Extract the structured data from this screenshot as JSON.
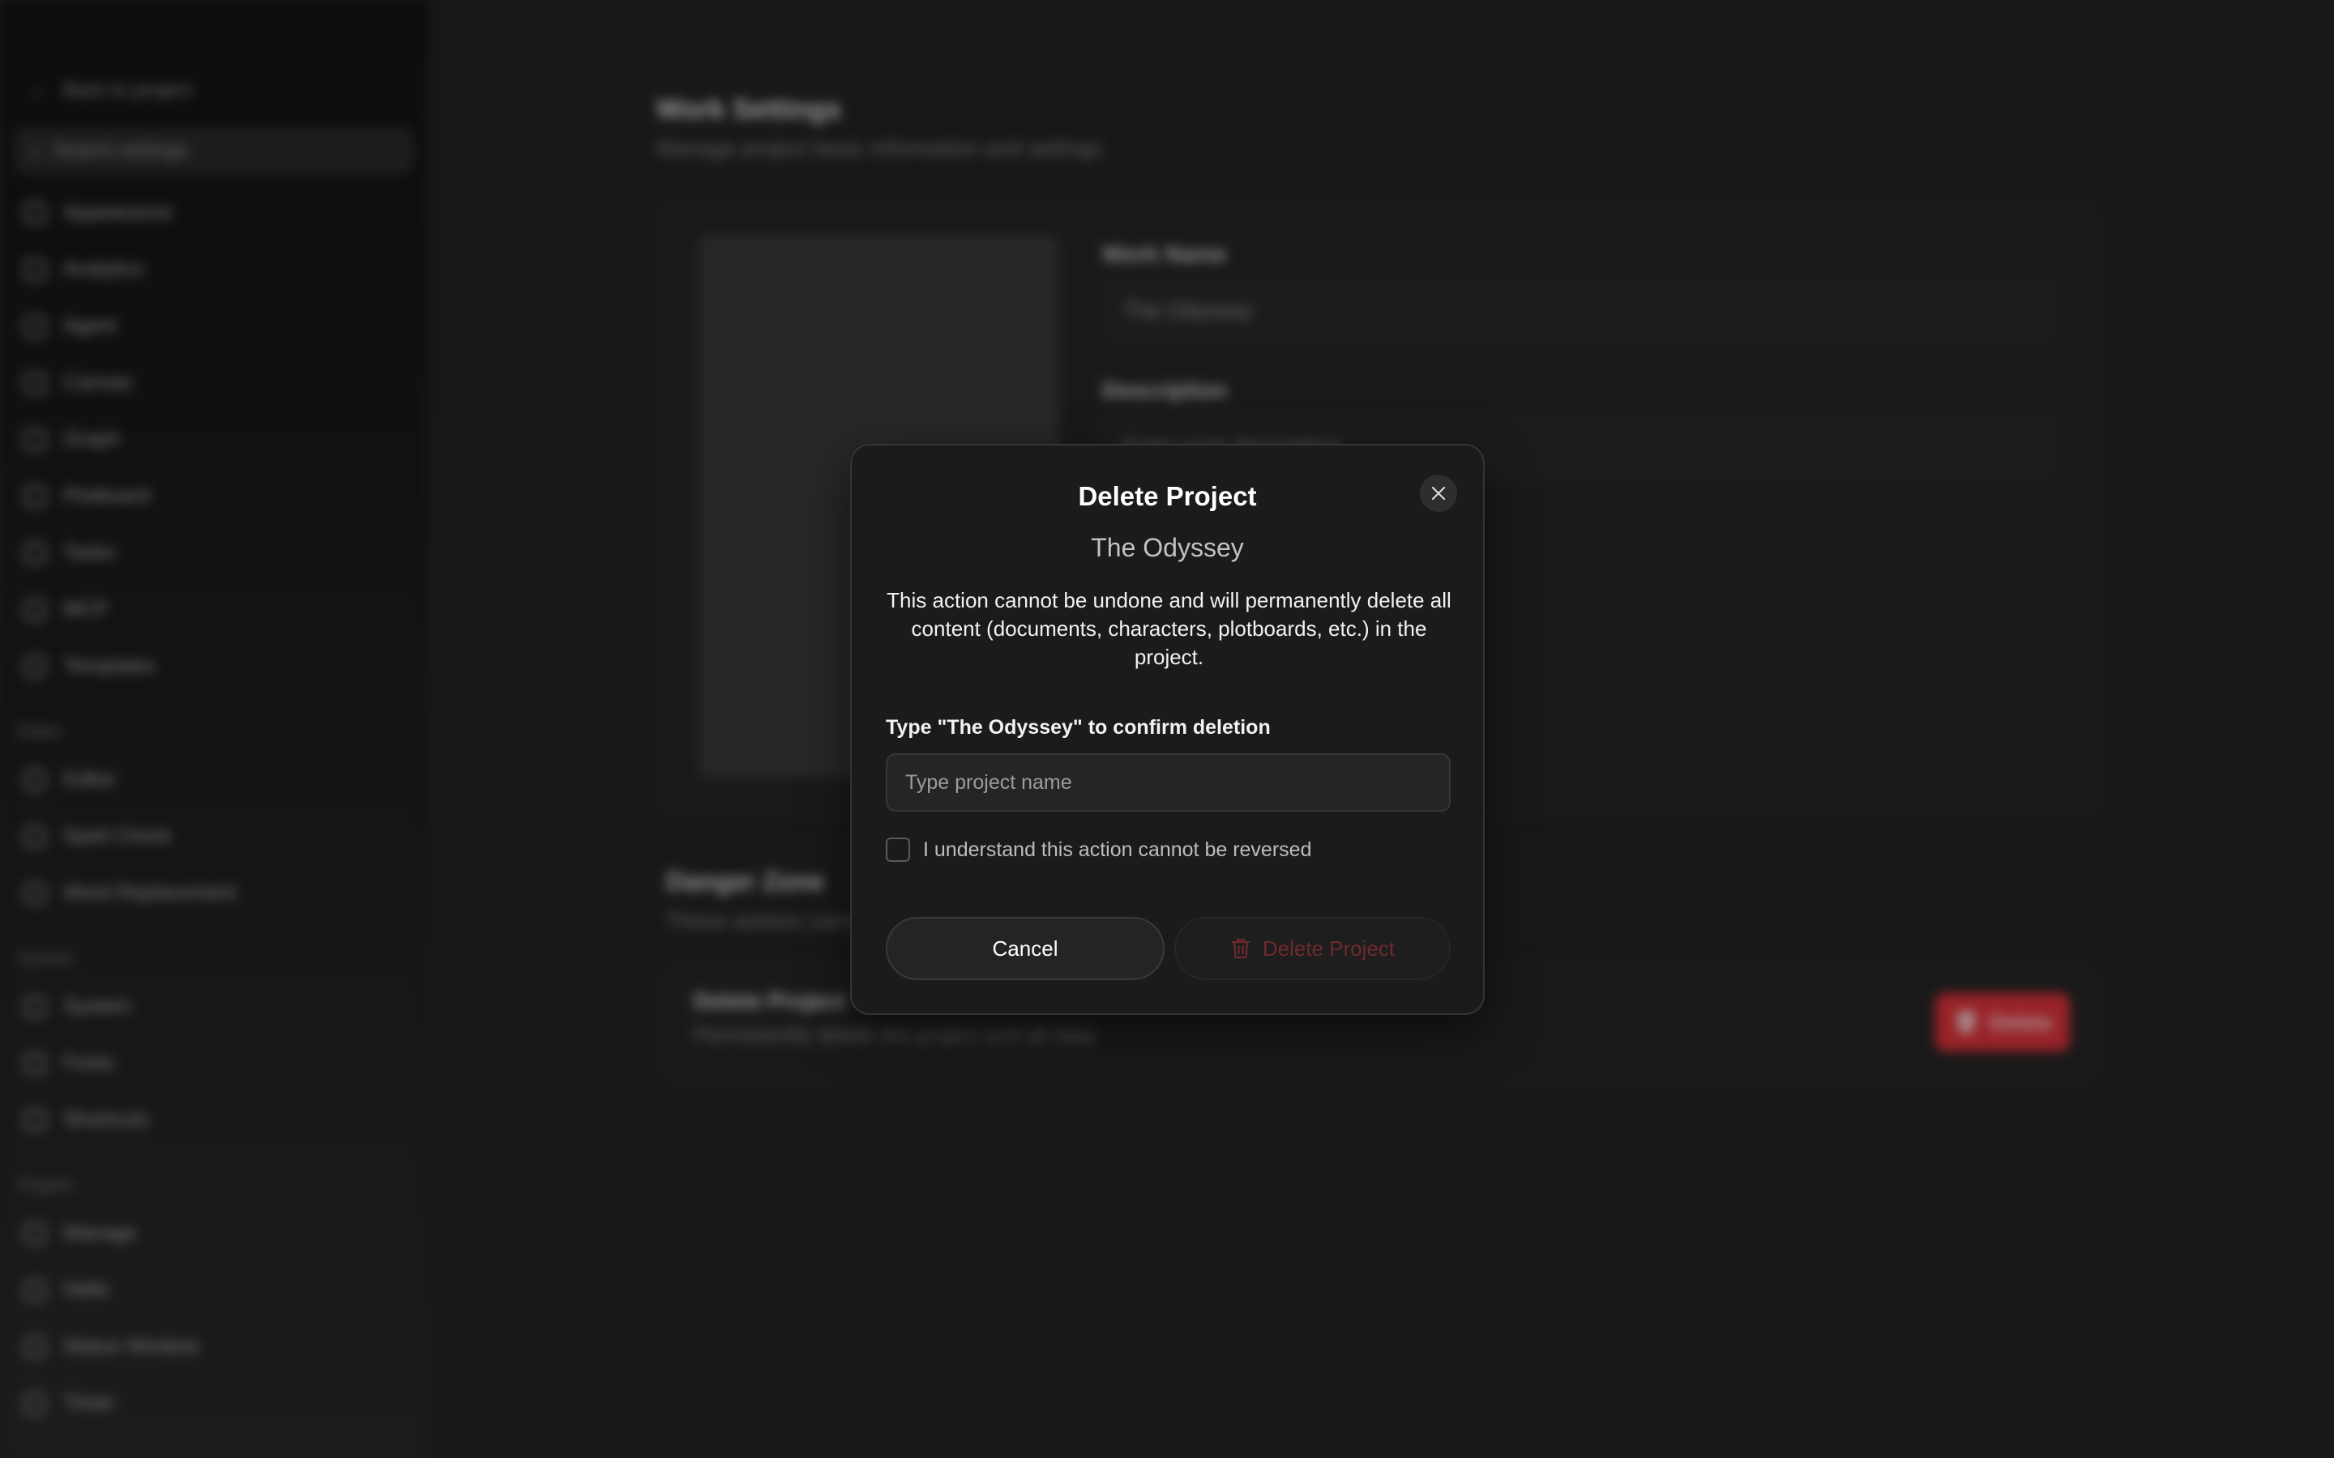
{
  "sidebar": {
    "back_label": "Back to project",
    "search_placeholder": "Search settings",
    "items": [
      {
        "label": "Appearance",
        "icon": "sparkle-icon"
      },
      {
        "label": "Analytics",
        "icon": "chart-icon"
      },
      {
        "label": "Agent",
        "icon": "bot-icon"
      },
      {
        "label": "Canvas",
        "icon": "pen-icon"
      },
      {
        "label": "Graph",
        "icon": "graph-icon"
      },
      {
        "label": "Plotboard",
        "icon": "board-icon"
      },
      {
        "label": "Tasks",
        "icon": "task-icon"
      },
      {
        "label": "MCP",
        "icon": "plug-icon"
      },
      {
        "label": "Templates",
        "icon": "template-icon"
      }
    ],
    "sections": [
      {
        "title": "Editor",
        "items": [
          {
            "label": "Editor",
            "icon": "edit-icon"
          },
          {
            "label": "Spell Check",
            "icon": "spellcheck-icon"
          },
          {
            "label": "Word Replacement",
            "icon": "replace-icon"
          }
        ]
      },
      {
        "title": "System",
        "items": [
          {
            "label": "System",
            "icon": "monitor-icon"
          },
          {
            "label": "Fonts",
            "icon": "font-icon"
          },
          {
            "label": "Shortcuts",
            "icon": "keyboard-icon"
          }
        ]
      },
      {
        "title": "Plugins",
        "items": [
          {
            "label": "Manage",
            "icon": "puzzle-icon"
          },
          {
            "label": "Hello",
            "icon": "wave-icon"
          },
          {
            "label": "Status Window",
            "icon": "window-icon"
          },
          {
            "label": "Timer",
            "icon": "timer-icon"
          }
        ]
      }
    ]
  },
  "settings": {
    "title": "Work Settings",
    "subtitle": "Manage project basic information and settings",
    "work_name_label": "Work Name",
    "work_name_value": "The Odyssey",
    "description_label": "Description",
    "description_placeholder": "Enter work description"
  },
  "danger_zone": {
    "title": "Danger Zone",
    "subtitle": "These actions cannot be undone",
    "row_title": "Delete Project",
    "row_desc": "Permanently delete the project and all data",
    "button_label": "Delete"
  },
  "modal": {
    "title": "Delete Project",
    "project_name": "The Odyssey",
    "warning": "This action cannot be undone and will permanently delete all content (documents, characters, plotboards, etc.) in the project.",
    "confirm_label": "Type \"The Odyssey\" to confirm deletion",
    "input_placeholder": "Type project name",
    "input_value": "",
    "ack_label": "I understand this action cannot be reversed",
    "ack_checked": false,
    "cancel_label": "Cancel",
    "delete_label": "Delete Project",
    "delete_enabled": false
  },
  "colors": {
    "danger": "#e0333c",
    "danger_disabled_text": "#6e2a2e",
    "modal_bg": "#1b1b1b"
  }
}
